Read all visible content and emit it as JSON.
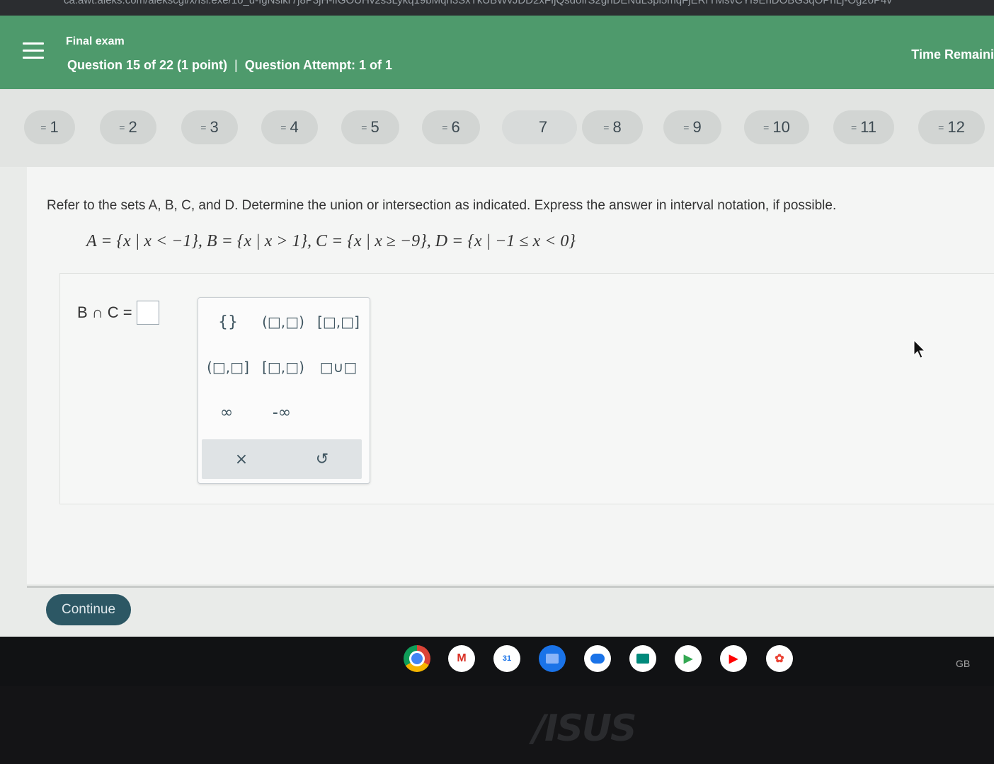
{
  "browser": {
    "url": "ca.awt.aleks.com/alekscgi/x/Isl.exe/1o_u-IgNslkr7j8P3jH-lIGOUHv2s3Lykq19bMqh3SxTkUBWvJDD2xFIjQsdoIrS2gnDENdL3pi5mqFjERrTMsvCYI9EnDOBG3qOPnLj-Og2oP4v"
  },
  "header": {
    "exam_title": "Final exam",
    "question_label": "Question 15 of 22 (1 point)",
    "separator": "|",
    "attempt_label": "Question Attempt: 1 of 1",
    "time_label": "Time Remaini"
  },
  "question_nav": [
    {
      "num": "1",
      "answered": true
    },
    {
      "num": "2",
      "answered": true
    },
    {
      "num": "3",
      "answered": true
    },
    {
      "num": "4",
      "answered": true
    },
    {
      "num": "5",
      "answered": true
    },
    {
      "num": "6",
      "answered": true
    },
    {
      "num": "7",
      "answered": false
    },
    {
      "num": "8",
      "answered": true
    },
    {
      "num": "9",
      "answered": true
    },
    {
      "num": "10",
      "answered": true
    },
    {
      "num": "11",
      "answered": true
    },
    {
      "num": "12",
      "answered": true
    }
  ],
  "answered_mark": "=",
  "problem": {
    "prompt": "Refer to the sets A, B, C, and D. Determine the union or intersection as indicated. Express the answer in interval notation, if possible.",
    "sets": "A = {x | x < −1}, B = {x | x > 1}, C = {x | x ≥ −9}, D = {x | −1 ≤ x < 0}",
    "expression": "B ∩ C ="
  },
  "palette": {
    "empty_set": "{}",
    "open_open": "(□,□)",
    "closed_closed": "[□,□]",
    "open_closed": "(□,□]",
    "closed_open": "[□,□)",
    "union": "□∪□",
    "infinity": "∞",
    "neg_infinity": "-∞",
    "clear": "×",
    "undo": "↺"
  },
  "footer": {
    "continue_label": "Continue"
  },
  "taskbar": {
    "keyboard_layout": "GB"
  },
  "device": {
    "brand": "/ISUS"
  },
  "colors": {
    "header_green": "#4e9a6c",
    "continue_bg": "#2c5764"
  }
}
